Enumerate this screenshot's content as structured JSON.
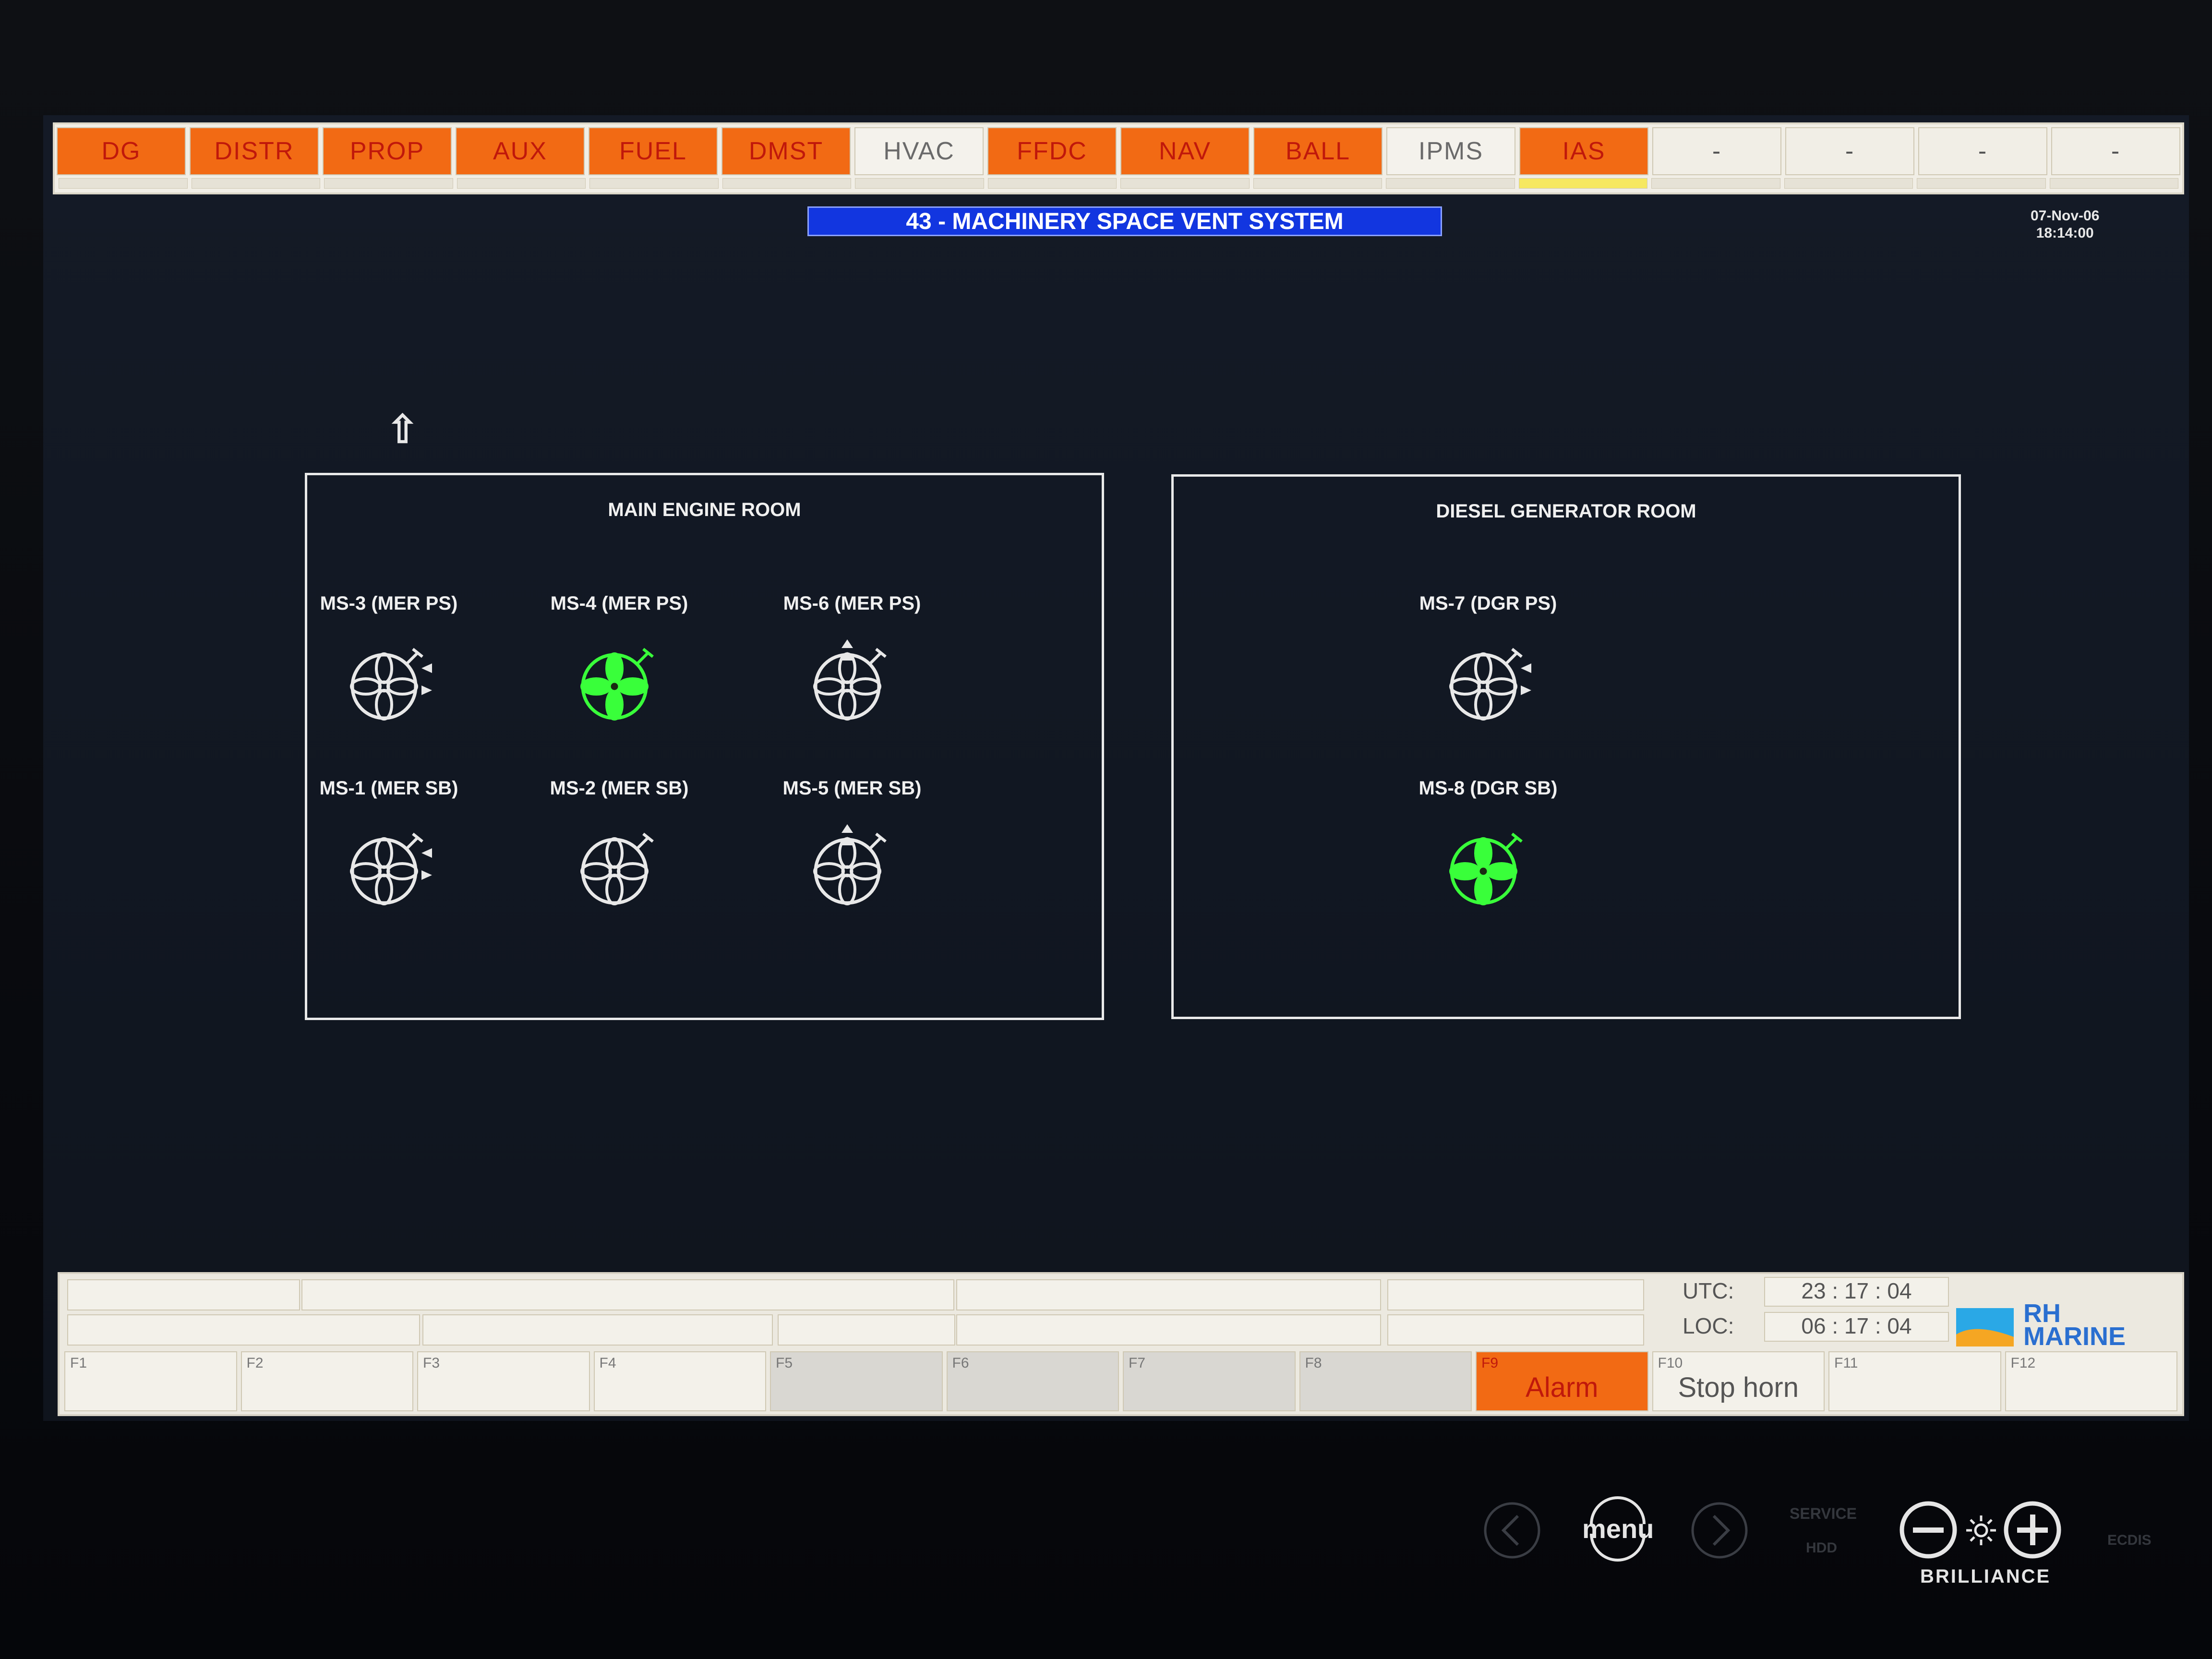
{
  "top_tabs": [
    {
      "label": "DG",
      "style": "orange"
    },
    {
      "label": "DISTR",
      "style": "orange"
    },
    {
      "label": "PROP",
      "style": "orange"
    },
    {
      "label": "AUX",
      "style": "orange"
    },
    {
      "label": "FUEL",
      "style": "orange"
    },
    {
      "label": "DMST",
      "style": "orange"
    },
    {
      "label": "HVAC",
      "style": "plain"
    },
    {
      "label": "FFDC",
      "style": "orange"
    },
    {
      "label": "NAV",
      "style": "orange"
    },
    {
      "label": "BALL",
      "style": "orange"
    },
    {
      "label": "IPMS",
      "style": "plain"
    },
    {
      "label": "IAS",
      "style": "orange"
    },
    {
      "label": "-",
      "style": "dash"
    },
    {
      "label": "-",
      "style": "dash"
    },
    {
      "label": "-",
      "style": "dash"
    },
    {
      "label": "-",
      "style": "dash"
    }
  ],
  "page_title": "43 - MACHINERY SPACE VENT SYSTEM",
  "date": "07-Nov-06",
  "time": "18:14:00",
  "up_arrow": "⇧",
  "main_engine_room": {
    "title": "MAIN ENGINE ROOM",
    "fans": [
      {
        "label": "MS-3 (MER PS)",
        "state": "stopped",
        "indicator": "side"
      },
      {
        "label": "MS-4 (MER PS)",
        "state": "running",
        "indicator": "none"
      },
      {
        "label": "MS-6 (MER PS)",
        "state": "stopped",
        "indicator": "up"
      },
      {
        "label": "MS-1 (MER SB)",
        "state": "stopped",
        "indicator": "side"
      },
      {
        "label": "MS-2 (MER SB)",
        "state": "stopped",
        "indicator": "none"
      },
      {
        "label": "MS-5 (MER SB)",
        "state": "stopped",
        "indicator": "up"
      }
    ]
  },
  "diesel_generator_room": {
    "title": "DIESEL GENERATOR ROOM",
    "fans": [
      {
        "label": "MS-7 (DGR PS)",
        "state": "stopped",
        "indicator": "side"
      },
      {
        "label": "MS-8 (DGR SB)",
        "state": "running",
        "indicator": "none"
      }
    ]
  },
  "clock": {
    "utc_label": "UTC:",
    "utc_value": "23 : 17 : 04",
    "loc_label": "LOC:",
    "loc_value": "06 : 17 : 04"
  },
  "logo": {
    "line1": "RH",
    "line2": "MARINE"
  },
  "function_keys": [
    {
      "num": "F1",
      "label": "",
      "style": "plain"
    },
    {
      "num": "F2",
      "label": "",
      "style": "plain"
    },
    {
      "num": "F3",
      "label": "",
      "style": "plain"
    },
    {
      "num": "F4",
      "label": "",
      "style": "plain"
    },
    {
      "num": "F5",
      "label": "",
      "style": "grey"
    },
    {
      "num": "F6",
      "label": "",
      "style": "grey"
    },
    {
      "num": "F7",
      "label": "",
      "style": "grey"
    },
    {
      "num": "F8",
      "label": "",
      "style": "grey"
    },
    {
      "num": "F9",
      "label": "Alarm",
      "style": "alarm"
    },
    {
      "num": "F10",
      "label": "Stop horn",
      "style": "plain"
    },
    {
      "num": "F11",
      "label": "",
      "style": "plain"
    },
    {
      "num": "F12",
      "label": "",
      "style": "plain"
    }
  ],
  "hardware": {
    "menu": "menu",
    "brilliance": "BRILLIANCE",
    "service": "SERVICE",
    "hdd": "HDD",
    "ecdis": "ECDIS"
  },
  "colors": {
    "running": "#39ff3a",
    "stopped": "#e8e8e8",
    "tab_orange": "#f26a14",
    "tab_text": "#c0180b",
    "title_blue": "#1236e0"
  }
}
